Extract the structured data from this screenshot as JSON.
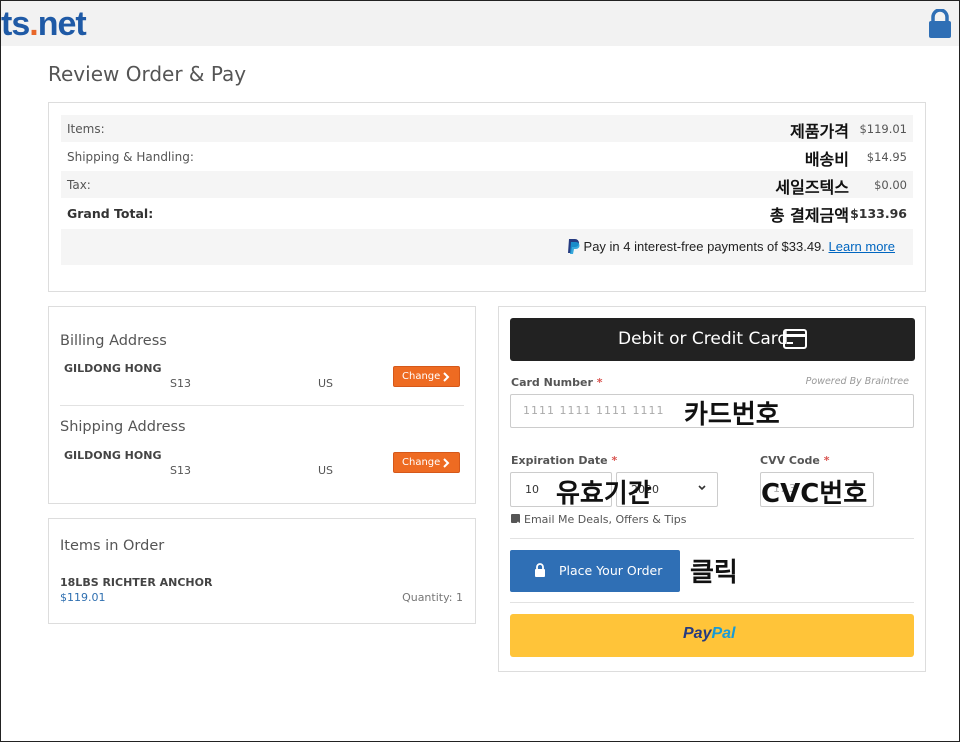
{
  "header": {
    "logo_main": "ts",
    "logo_dot": ".",
    "logo_tld": "net"
  },
  "page_title": "Review Order & Pay",
  "summary": {
    "rows": [
      {
        "label": "Items:",
        "annotation": "제품가격",
        "value": "$119.01"
      },
      {
        "label": "Shipping & Handling:",
        "annotation": "배송비",
        "value": "$14.95"
      },
      {
        "label": "Tax:",
        "annotation": "세일즈텍스",
        "value": "$0.00"
      },
      {
        "label": "Grand Total:",
        "annotation": "총 결제금액",
        "value": "$133.96"
      }
    ],
    "paypal_later": {
      "text": "Pay in 4 interest-free payments of $33.49.",
      "link": "Learn more"
    }
  },
  "billing": {
    "title": "Billing Address",
    "name": "GILDONG HONG",
    "street": "S13",
    "country": "US",
    "change_label": "Change"
  },
  "shipping": {
    "title": "Shipping Address",
    "name": "GILDONG HONG",
    "street": "S13",
    "country": "US",
    "change_label": "Change"
  },
  "items_in_order": {
    "title": "Items in Order",
    "items": [
      {
        "name": "18LBS RICHTER ANCHOR",
        "price": "$119.01",
        "quantity": "Quantity: 1"
      }
    ]
  },
  "payment": {
    "card_button_label": "Debit or Credit Card",
    "card_number_label": "Card Number",
    "required_mark": "*",
    "powered_by": "Powered By Braintree",
    "card_number_placeholder": "1111 1111 1111 1111",
    "card_number_annotation": "카드번호",
    "expiration_label": "Expiration Date",
    "exp_month": "10",
    "exp_year": "2020",
    "expiration_annotation": "유효기간",
    "cvv_label": "CVV Code",
    "cvv_placeholder": "123",
    "cvv_annotation": "CVC번호",
    "email_opt_in_label": "Email Me Deals, Offers & Tips",
    "email_opt_in_checked": true,
    "place_order_label": "Place Your Order",
    "place_order_annotation": "클릭",
    "paypal_label_pay": "Pay",
    "paypal_label_pal": "Pal"
  },
  "colors": {
    "brand_blue": "#1f5aa6",
    "accent_orange": "#ee6b22",
    "place_order_blue": "#2f6fb5",
    "paypal_yellow": "#ffc439",
    "card_button_dark": "#222222"
  }
}
